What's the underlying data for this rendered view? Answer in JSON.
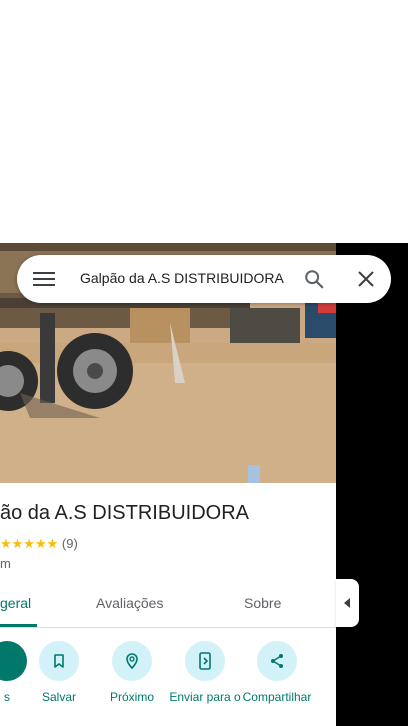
{
  "search": {
    "query": "Galpão da A.S DISTRIBUIDORA"
  },
  "place": {
    "title": "ão da A.S DISTRIBUIDORA",
    "stars": "★★★★★",
    "review_count": "(9)",
    "distance": "m"
  },
  "tabs": [
    {
      "label": "geral"
    },
    {
      "label": "Avaliações"
    },
    {
      "label": "Sobre"
    }
  ],
  "actions": [
    {
      "label": "s",
      "icon": "directions-icon"
    },
    {
      "label": "Salvar",
      "icon": "bookmark-icon"
    },
    {
      "label": "Próximo",
      "icon": "nearby-icon"
    },
    {
      "label": "Enviar para o",
      "icon": "send-to-phone-icon"
    },
    {
      "label": "Compartilhar",
      "icon": "share-icon"
    }
  ],
  "colors": {
    "accent": "#00796b",
    "action_bg": "#d2f1f8",
    "star": "#fbbc04"
  }
}
